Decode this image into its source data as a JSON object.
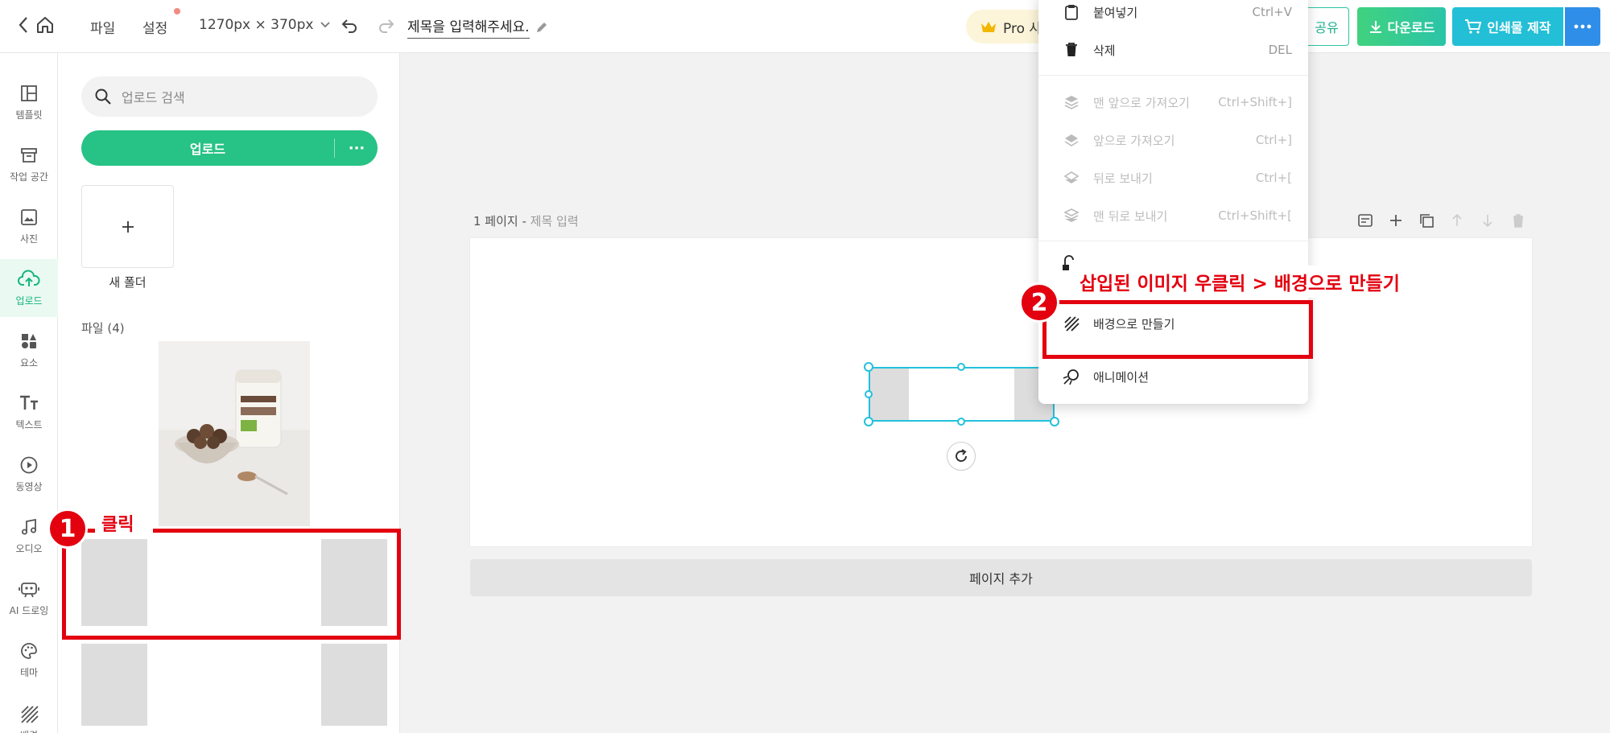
{
  "topbar": {
    "file_menu": "파일",
    "settings_menu": "설정",
    "size": "1270px × 370px",
    "title_placeholder": "제목을 입력해주세요.",
    "pro_label": "Pro 사용",
    "share_label": "공유",
    "download_label": "다운로드",
    "print_label": "인쇄물 제작"
  },
  "rail": {
    "items": [
      {
        "label": "템플릿",
        "icon": "template-icon"
      },
      {
        "label": "작업 공간",
        "icon": "archive-icon"
      },
      {
        "label": "사진",
        "icon": "photo-icon"
      },
      {
        "label": "업로드",
        "icon": "upload-cloud-icon",
        "active": true
      },
      {
        "label": "요소",
        "icon": "elements-icon"
      },
      {
        "label": "텍스트",
        "icon": "text-icon"
      },
      {
        "label": "동영상",
        "icon": "video-icon"
      },
      {
        "label": "오디오",
        "icon": "music-icon"
      },
      {
        "label": "AI 드로잉",
        "icon": "ai-drawing-icon"
      },
      {
        "label": "테마",
        "icon": "palette-icon"
      },
      {
        "label": "배경",
        "icon": "background-icon"
      }
    ]
  },
  "panel": {
    "search_placeholder": "업로드 검색",
    "upload_label": "업로드",
    "upload_more": "···",
    "new_folder_label": "새 폴더",
    "files_label": "파일 (4)"
  },
  "canvas": {
    "page_number": "1 페이지 - ",
    "page_title_placeholder": "제목 입력",
    "add_page_label": "페이지 추가"
  },
  "context_menu": {
    "items": [
      {
        "label": "붙여넣기",
        "shortcut": "Ctrl+V",
        "icon": "clipboard-icon",
        "disabled": false
      },
      {
        "label": "삭제",
        "shortcut": "DEL",
        "icon": "trash-icon",
        "disabled": false
      },
      {
        "label": "맨 앞으로 가져오기",
        "shortcut": "Ctrl+Shift+]",
        "icon": "layers-icon",
        "disabled": true
      },
      {
        "label": "앞으로 가져오기",
        "shortcut": "Ctrl+]",
        "icon": "layers-icon",
        "disabled": true
      },
      {
        "label": "뒤로 보내기",
        "shortcut": "Ctrl+[",
        "icon": "layers-icon",
        "disabled": true
      },
      {
        "label": "맨 뒤로 보내기",
        "shortcut": "Ctrl+Shift+[",
        "icon": "layers-icon",
        "disabled": true
      },
      {
        "label": "배경으로 만들기",
        "shortcut": "",
        "icon": "background-hatch-icon",
        "disabled": false
      },
      {
        "label": "애니메이션",
        "shortcut": "",
        "icon": "animation-icon",
        "disabled": false
      }
    ]
  },
  "annotations": {
    "step1_number": "1",
    "step1_text": "클릭",
    "step2_number": "2",
    "step2_text": "삽입된 이미지 우클릭 > 배경으로 만들기"
  },
  "colors": {
    "accent_green": "#27c285",
    "selection_cyan": "#22c1dc",
    "annotation_red": "#e3000f"
  }
}
